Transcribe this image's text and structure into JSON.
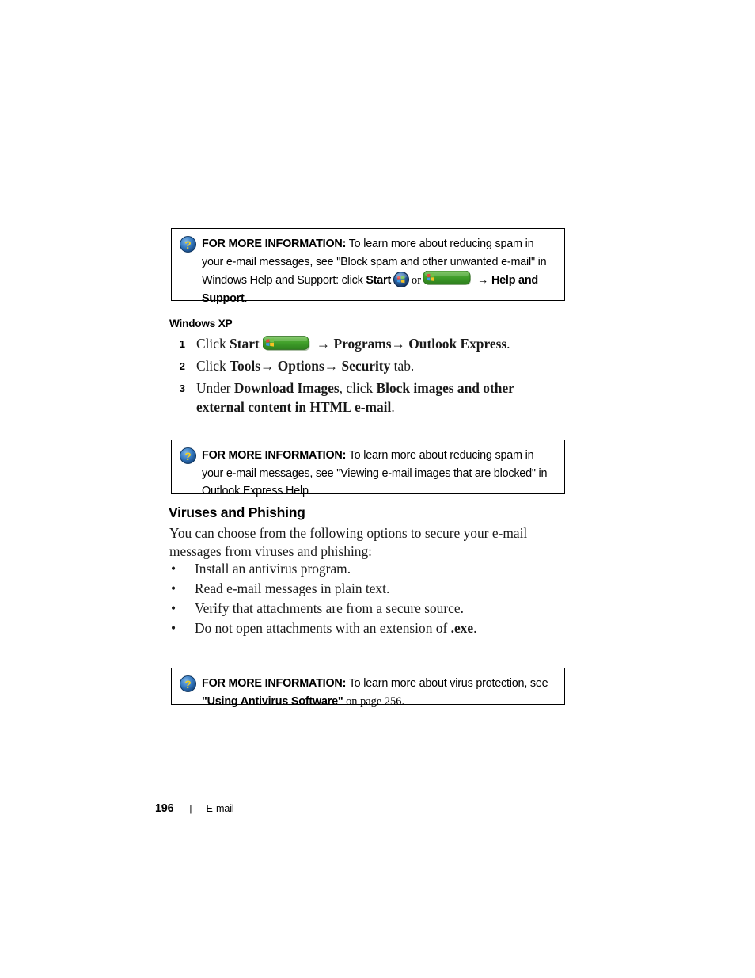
{
  "page": {
    "footer_page_number": "196",
    "footer_separator": "|",
    "footer_section": "E-mail"
  },
  "colors": {
    "text": "#000000",
    "body_text": "#1a1a1a",
    "box_border": "#000000",
    "help_icon_blue": "#2f6fb5",
    "help_icon_yellow": "#f2cf22",
    "xp_button_green": "#3f9a2e",
    "vista_orb_blue": "#1b4f91"
  },
  "note_box_1": {
    "icon": "help-question-icon",
    "lead": "FOR MORE INFORMATION:",
    "text_part_1": " To learn more about reducing spam in your e-mail messages, see \"Block spam and other unwanted e-mail\" in Windows Help and Support: click ",
    "start_label": "Start",
    "vista_orb_icon": "windows-vista-start-orb-icon",
    "or_label": "or",
    "xp_start_icon": "windows-xp-start-button-icon",
    "arrow": "→",
    "text_part_2": " Help and Support",
    "period": "."
  },
  "windows_xp_section": {
    "heading": "Windows XP",
    "steps": [
      {
        "number": "1",
        "prefix": "Click ",
        "bold_1": "Start",
        "xp_start_icon": "windows-xp-start-button-icon",
        "arrow_1": "→",
        "bold_2": " Programs",
        "arrow_2": "→",
        "bold_3": " Outlook Express",
        "suffix": "."
      },
      {
        "number": "2",
        "prefix": "Click ",
        "bold_1": "Tools",
        "arrow_1": "→",
        "bold_2": " Options",
        "arrow_2": "→",
        "bold_3": " Security",
        "suffix": " tab."
      },
      {
        "number": "3",
        "prefix": "Under ",
        "bold_1": "Download Images",
        "middle": ", click ",
        "bold_2": "Block images and other external content in HTML e-mail",
        "suffix": "."
      }
    ]
  },
  "note_box_2": {
    "icon": "help-question-icon",
    "lead": "FOR MORE INFORMATION:",
    "text": " To learn more about reducing spam in your e-mail messages, see \"Viewing e-mail images that are blocked\" in Outlook Express Help."
  },
  "viruses_section": {
    "heading": "Viruses and Phishing",
    "intro": "You can choose from the following options to secure your e-mail messages from viruses and phishing:",
    "bullet_char": "•",
    "bullets": [
      {
        "text": "Install an antivirus program.",
        "bold_tail": "",
        "tail": ""
      },
      {
        "text": "Read e-mail messages in plain text.",
        "bold_tail": "",
        "tail": ""
      },
      {
        "text": "Verify that attachments are from a secure source.",
        "bold_tail": "",
        "tail": ""
      },
      {
        "text": "Do not open attachments with an extension of ",
        "bold_tail": ".exe",
        "tail": "."
      }
    ]
  },
  "note_box_3": {
    "icon": "help-question-icon",
    "lead": "FOR MORE INFORMATION:",
    "text_part_1": " To learn more about virus protection, see ",
    "quoted_bold": "\"Using Antivirus Software\"",
    "text_part_2": " on page 256."
  }
}
